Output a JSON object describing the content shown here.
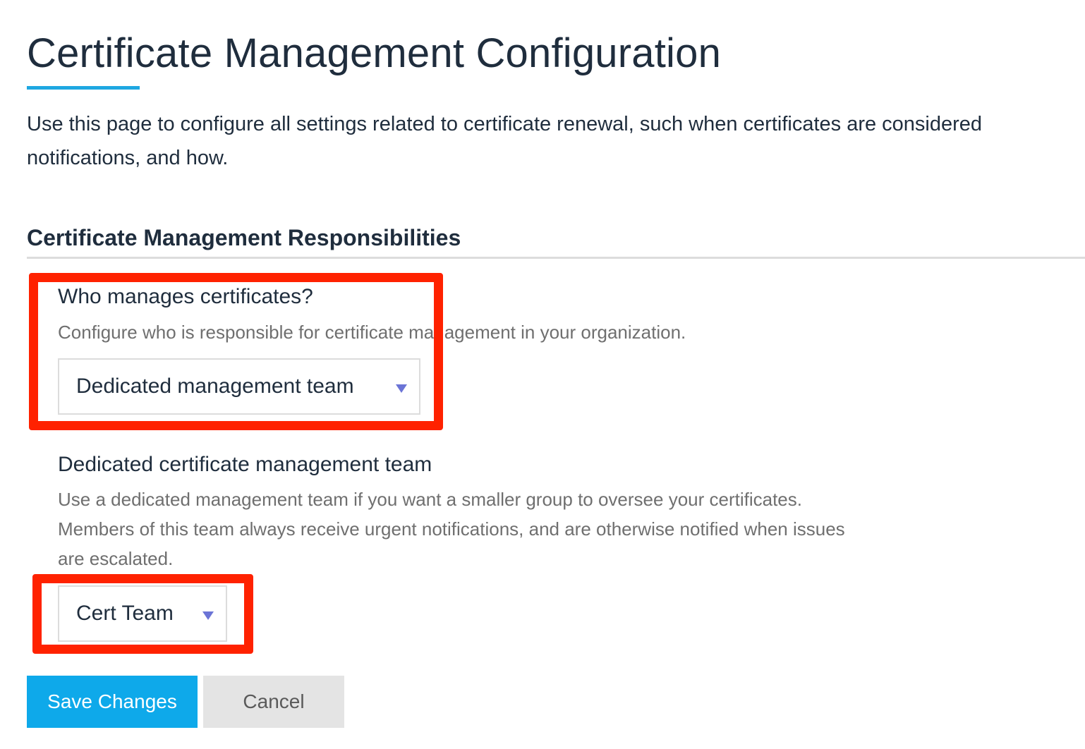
{
  "page": {
    "title": "Certificate Management Configuration",
    "intro_line1": "Use this page to configure all settings related to certificate renewal, such when certificates are considered",
    "intro_line2": "notifications, and how."
  },
  "section": {
    "title": "Certificate Management Responsibilities"
  },
  "who_manages": {
    "label": "Who manages certificates?",
    "help": "Configure who is responsible for certificate management in your organization.",
    "selected": "Dedicated management team"
  },
  "dedicated_team": {
    "label": "Dedicated certificate management team",
    "help_line1": "Use a dedicated management team if you want a smaller group to oversee your certificates.",
    "help_line2": "Members of this team always receive urgent notifications, and are otherwise notified when issues",
    "help_line3": "are escalated.",
    "selected": "Cert Team"
  },
  "actions": {
    "save_label": "Save Changes",
    "cancel_label": "Cancel"
  },
  "colors": {
    "accent": "#1ea7e1",
    "primary_button": "#0ea9ea",
    "highlight": "#ff2200",
    "caret": "#6b74d6"
  }
}
